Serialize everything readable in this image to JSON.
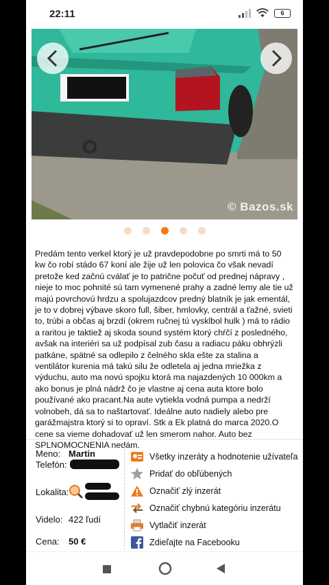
{
  "status_bar": {
    "time": "22:11",
    "battery": "6"
  },
  "gallery": {
    "watermark": "Bazos.sk",
    "dot_count": 5,
    "active_index": 2
  },
  "description": "Predám tento verkel ktorý je už pravdepodobne po smrti má to 50 kw čo robí stádo 67 koní ale žije už len polovica čo však nevadí pretože ked začnú cválať je to patrične počuť od prednej nápravy , nieje to moc pohnité sú tam vymenené prahy a zadné lemy ale tie už majú povrchovú hrdzu a spolujazdcov predný blatník je jak ementál, je to v dobrej výbave skoro full, šiber, hmlovky, centrál a ťažné, svieti to, trúbi a občas aj brzdí (okrem ručnej tú vysklbol hulk ) má to rádio a raritou je taktiež aj skoda sound systém ktorý chŕčí z posledného, avšak na interiéri sa už podpísal zub času a radiacu páku obhrýzli patkáne, spätné sa odlepilo z čelného skla ešte za stalina a ventilátor kurenia má takú silu že odletela aj jedna mriežka z výduchu, auto ma novú spojku ktorá ma najazdených 10 000km a ako bonus je plná nádrž čo je vlastne aj cena auta ktore bolo používané ako pracant.Na aute vytiekla vodná pumpa a nedrží volnobeh, dá sa to naštartovať. Ideálne auto nadiely alebo pre garážmajstra ktorý si to opraví. Stk a Ek platná do marca 2020.O cene sa vieme dohadovať už len smerom nahor. Auto bez SPLNOMOCNENIA nedám.",
  "seller": {
    "name_label": "Meno:",
    "name": "Martin",
    "phone_label": "Telefón:",
    "location_label": "Lokalita:",
    "views_label": "Videlo:",
    "views": "422 ľudí",
    "price_label": "Cena:",
    "price": "50 €"
  },
  "actions": [
    {
      "label": "Všetky inzeráty a hodnotenie užívateľa",
      "icon": "user-card-icon"
    },
    {
      "label": "Pridať do obľúbených",
      "icon": "star-icon"
    },
    {
      "label": "Označiť zlý inzerát",
      "icon": "warning-icon"
    },
    {
      "label": "Označiť chybnú kategóriu inzerátu",
      "icon": "swap-arrows-icon"
    },
    {
      "label": "Vytlačiť inzerát",
      "icon": "printer-icon"
    },
    {
      "label": "Zdieľajte na Facebooku",
      "icon": "facebook-icon"
    }
  ],
  "colors": {
    "accent": "#f07a1c",
    "car": "#2fb89a"
  }
}
